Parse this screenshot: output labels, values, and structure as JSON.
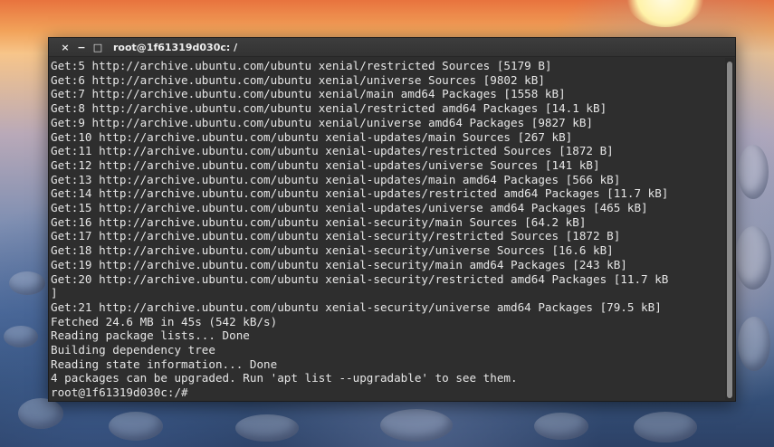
{
  "window": {
    "title": "root@1f61319d030c: /",
    "buttons": {
      "close": "×",
      "minimize": "−",
      "maximize": "□"
    }
  },
  "terminal": {
    "lines": [
      "Get:5 http://archive.ubuntu.com/ubuntu xenial/restricted Sources [5179 B]",
      "Get:6 http://archive.ubuntu.com/ubuntu xenial/universe Sources [9802 kB]",
      "Get:7 http://archive.ubuntu.com/ubuntu xenial/main amd64 Packages [1558 kB]",
      "Get:8 http://archive.ubuntu.com/ubuntu xenial/restricted amd64 Packages [14.1 kB]",
      "Get:9 http://archive.ubuntu.com/ubuntu xenial/universe amd64 Packages [9827 kB]",
      "Get:10 http://archive.ubuntu.com/ubuntu xenial-updates/main Sources [267 kB]",
      "Get:11 http://archive.ubuntu.com/ubuntu xenial-updates/restricted Sources [1872 B]",
      "Get:12 http://archive.ubuntu.com/ubuntu xenial-updates/universe Sources [141 kB]",
      "Get:13 http://archive.ubuntu.com/ubuntu xenial-updates/main amd64 Packages [566 kB]",
      "Get:14 http://archive.ubuntu.com/ubuntu xenial-updates/restricted amd64 Packages [11.7 kB]",
      "Get:15 http://archive.ubuntu.com/ubuntu xenial-updates/universe amd64 Packages [465 kB]",
      "Get:16 http://archive.ubuntu.com/ubuntu xenial-security/main Sources [64.2 kB]",
      "Get:17 http://archive.ubuntu.com/ubuntu xenial-security/restricted Sources [1872 B]",
      "Get:18 http://archive.ubuntu.com/ubuntu xenial-security/universe Sources [16.6 kB]",
      "Get:19 http://archive.ubuntu.com/ubuntu xenial-security/main amd64 Packages [243 kB]",
      "Get:20 http://archive.ubuntu.com/ubuntu xenial-security/restricted amd64 Packages [11.7 kB",
      "]",
      "Get:21 http://archive.ubuntu.com/ubuntu xenial-security/universe amd64 Packages [79.5 kB]",
      "Fetched 24.6 MB in 45s (542 kB/s)",
      "Reading package lists... Done",
      "Building dependency tree",
      "Reading state information... Done",
      "4 packages can be upgraded. Run 'apt list --upgradable' to see them.",
      "root@1f61319d030c:/#"
    ]
  },
  "icons": {
    "close": "close-icon",
    "minimize": "minimize-icon",
    "maximize": "maximize-icon"
  },
  "colors": {
    "terminal_bg": "#2e2e2e",
    "terminal_fg": "#e6e6e6",
    "titlebar_bg": "#3a3a3a",
    "scrollbar_thumb": "#8a8a8a"
  }
}
